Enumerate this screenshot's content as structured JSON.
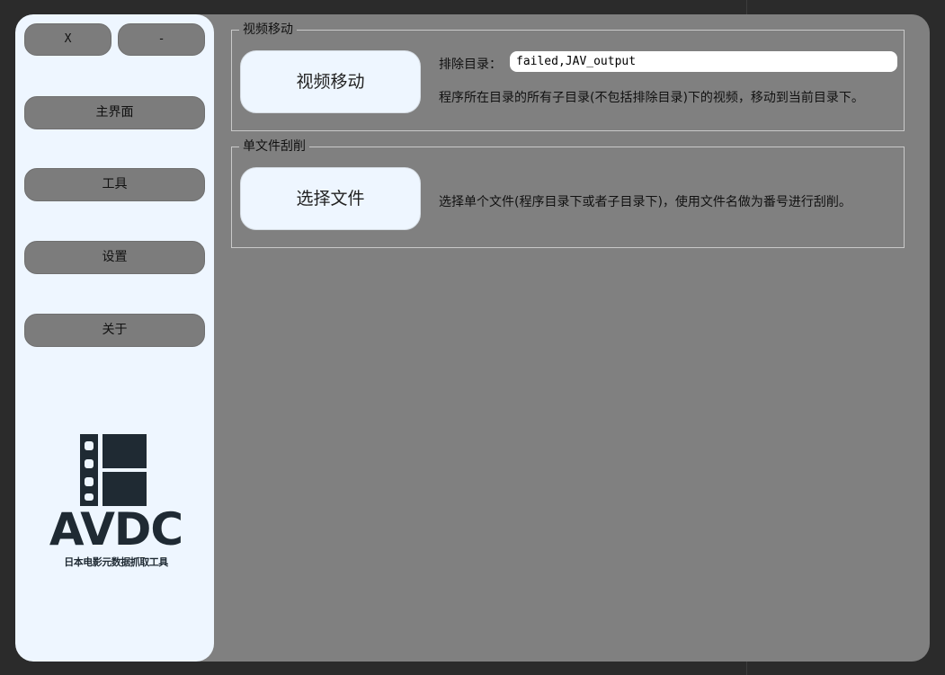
{
  "window_controls": {
    "close_label": "X",
    "minimize_label": "-"
  },
  "sidebar": {
    "items": [
      {
        "label": "主界面"
      },
      {
        "label": "工具"
      },
      {
        "label": "设置"
      },
      {
        "label": "关于"
      }
    ],
    "logo": {
      "word": "AVDC",
      "subtitle": "日本电影元数据抓取工具",
      "color": "#1f2a33",
      "icon": "film-strip-icon"
    }
  },
  "video_move": {
    "group_title": "视频移动",
    "button_label": "视频移动",
    "exclude_label": "排除目录：",
    "exclude_value": "failed,JAV_output",
    "description": "程序所在目录的所有子目录(不包括排除目录)下的视频，移动到当前目录下。"
  },
  "single_file": {
    "group_title": "单文件刮削",
    "button_label": "选择文件",
    "description": "选择单个文件(程序目录下或者子目录下)，使用文件名做为番号进行刮削。"
  },
  "colors": {
    "window_bg": "#808080",
    "sidebar_bg": "#eef6ff",
    "pill_bg": "#7c7c7c",
    "outer_bg": "#2b2b2b"
  }
}
